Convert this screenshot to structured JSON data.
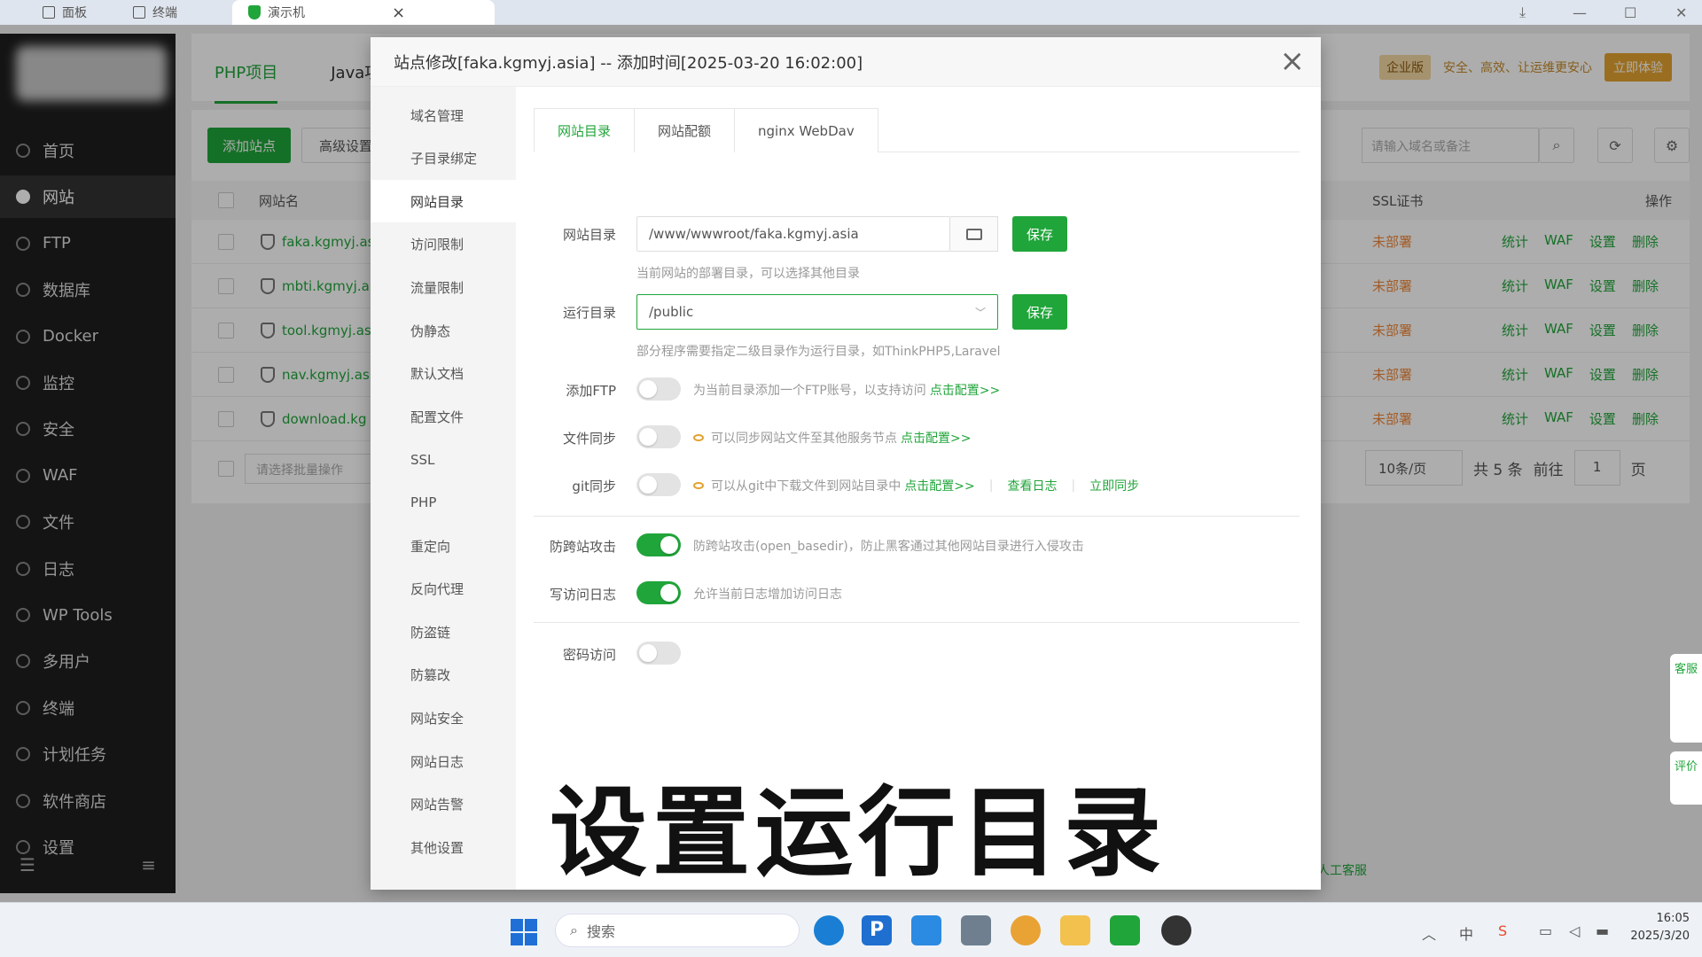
{
  "browser": {
    "tabs": [
      "面板",
      "终端",
      "演示机"
    ],
    "close_glyph": "×"
  },
  "sidebar": {
    "items": [
      "首页",
      "网站",
      "FTP",
      "数据库",
      "Docker",
      "监控",
      "安全",
      "WAF",
      "文件",
      "日志",
      "WP Tools",
      "多用户",
      "终端",
      "计划任务",
      "软件商店",
      "设置"
    ],
    "active_index": 1
  },
  "main": {
    "tabs": [
      "PHP项目",
      "Java项"
    ],
    "promo": {
      "badge": "企业版",
      "text": "安全、高效、让运维更安心",
      "button": "立即体验"
    },
    "toolbar": {
      "add_site": "添加站点",
      "advanced": "高级设置",
      "search_placeholder": "请输入域名或备注"
    },
    "table": {
      "headers": [
        "网站名",
        "SSL证书",
        "操作"
      ],
      "rows": [
        {
          "name": "faka.kgmyj.as",
          "ssl": "未部署"
        },
        {
          "name": "mbti.kgmyj.a",
          "ssl": "未部署"
        },
        {
          "name": "tool.kgmyj.as",
          "ssl": "未部署"
        },
        {
          "name": "nav.kgmyj.asi",
          "ssl": "未部署"
        },
        {
          "name": "download.kg",
          "ssl": "未部署"
        }
      ],
      "row_actions": [
        "统计",
        "WAF",
        "设置",
        "删除"
      ]
    },
    "batch_placeholder": "请选择批量操作",
    "pager": {
      "page_size": "10条/页",
      "total": "共 5 条",
      "goto": "前往",
      "page": "1",
      "page_unit": "页"
    },
    "footer_link": "人工客服"
  },
  "floating": {
    "service": "客服",
    "rate": "评价"
  },
  "dialog": {
    "title": "站点修改[faka.kgmyj.asia] -- 添加时间[2025-03-20 16:02:00]",
    "close": "×",
    "menu": [
      "域名管理",
      "子目录绑定",
      "网站目录",
      "访问限制",
      "流量限制",
      "伪静态",
      "默认文档",
      "配置文件",
      "SSL",
      "PHP",
      "重定向",
      "反向代理",
      "防盗链",
      "防篡改",
      "网站安全",
      "网站日志",
      "网站告警",
      "其他设置"
    ],
    "menu_active": 2,
    "sub_tabs": [
      "网站目录",
      "网站配额",
      "nginx WebDav"
    ],
    "site_dir": {
      "label": "网站目录",
      "value": "/www/wwwroot/faka.kgmyj.asia",
      "save": "保存",
      "hint": "当前网站的部署目录，可以选择其他目录"
    },
    "run_dir": {
      "label": "运行目录",
      "value": "/public",
      "save": "保存",
      "hint": "部分程序需要指定二级目录作为运行目录，如ThinkPHP5,Laravel"
    },
    "ftp": {
      "label": "添加FTP",
      "on": false,
      "hint": "为当前目录添加一个FTP账号，以支持访问",
      "link": "点击配置>>"
    },
    "file_sync": {
      "label": "文件同步",
      "on": false,
      "hint": "可以同步网站文件至其他服务节点",
      "link": "点击配置>>"
    },
    "git_sync": {
      "label": "git同步",
      "on": false,
      "hint": "可以从git中下载文件到网站目录中",
      "link": "点击配置>>",
      "view_log": "查看日志",
      "sync_now": "立即同步"
    },
    "anti_xss": {
      "label": "防跨站攻击",
      "on": true,
      "hint": "防跨站攻击(open_basedir)，防止黑客通过其他网站目录进行入侵攻击"
    },
    "access_log": {
      "label": "写访问日志",
      "on": true,
      "hint": "允许当前日志增加访问日志"
    },
    "password_access": {
      "label": "密码访问",
      "on": false
    }
  },
  "caption": "设置运行目录",
  "taskbar": {
    "search": "搜索",
    "time": "16:05",
    "date": "2025/3/20"
  },
  "colors": {
    "accent": "#20a53a",
    "warning": "#f0883a",
    "promo": "#e3a230"
  }
}
